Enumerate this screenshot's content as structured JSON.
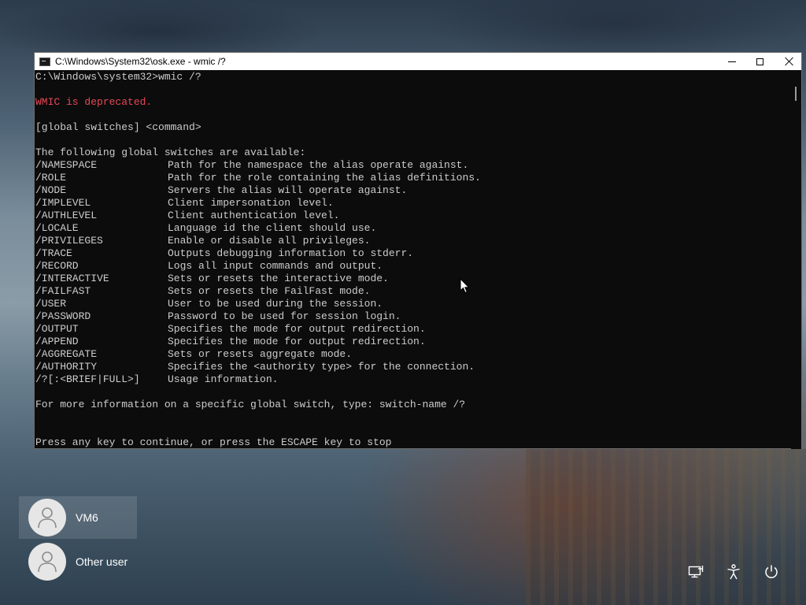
{
  "window": {
    "title": "C:\\Windows\\System32\\osk.exe - wmic  /?",
    "icon": "console-app-icon"
  },
  "console": {
    "prompt_line": "C:\\Windows\\system32>wmic /?",
    "deprecated": "WMIC is deprecated.",
    "usage": "[global switches] <command>",
    "switches_header": "The following global switches are available:",
    "switches": [
      {
        "name": "/NAMESPACE",
        "desc": "Path for the namespace the alias operate against."
      },
      {
        "name": "/ROLE",
        "desc": "Path for the role containing the alias definitions."
      },
      {
        "name": "/NODE",
        "desc": "Servers the alias will operate against."
      },
      {
        "name": "/IMPLEVEL",
        "desc": "Client impersonation level."
      },
      {
        "name": "/AUTHLEVEL",
        "desc": "Client authentication level."
      },
      {
        "name": "/LOCALE",
        "desc": "Language id the client should use."
      },
      {
        "name": "/PRIVILEGES",
        "desc": "Enable or disable all privileges."
      },
      {
        "name": "/TRACE",
        "desc": "Outputs debugging information to stderr."
      },
      {
        "name": "/RECORD",
        "desc": "Logs all input commands and output."
      },
      {
        "name": "/INTERACTIVE",
        "desc": "Sets or resets the interactive mode."
      },
      {
        "name": "/FAILFAST",
        "desc": "Sets or resets the FailFast mode."
      },
      {
        "name": "/USER",
        "desc": "User to be used during the session."
      },
      {
        "name": "/PASSWORD",
        "desc": "Password to be used for session login."
      },
      {
        "name": "/OUTPUT",
        "desc": "Specifies the mode for output redirection."
      },
      {
        "name": "/APPEND",
        "desc": "Specifies the mode for output redirection."
      },
      {
        "name": "/AGGREGATE",
        "desc": "Sets or resets aggregate mode."
      },
      {
        "name": "/AUTHORITY",
        "desc": "Specifies the <authority type> for the connection."
      },
      {
        "name": "/?[:<BRIEF|FULL>]",
        "desc": "Usage information."
      }
    ],
    "more_info": "For more information on a specific global switch, type: switch-name /?",
    "press_key": "Press any key to continue, or press the ESCAPE key to stop"
  },
  "users": [
    {
      "name": "VM6",
      "icon": "user-avatar-icon",
      "selected": true
    },
    {
      "name": "Other user",
      "icon": "user-avatar-icon",
      "selected": false
    }
  ],
  "system_icons": [
    "network-icon",
    "accessibility-icon",
    "power-icon"
  ],
  "colors": {
    "console_bg": "#0c0c0c",
    "console_text": "#cccccc",
    "error_text": "#e74856"
  }
}
